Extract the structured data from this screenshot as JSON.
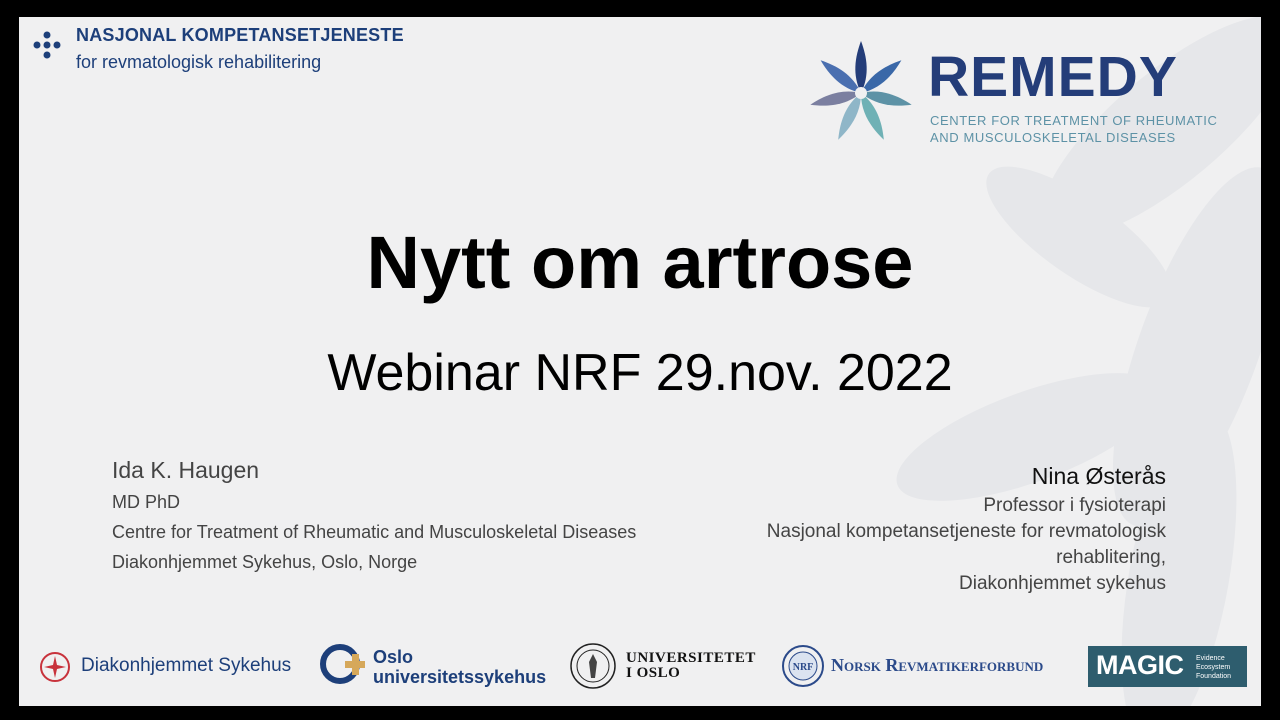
{
  "header": {
    "org_title": "NASJONAL KOMPETANSETJENESTE",
    "org_subtitle": "for revmatologisk rehabilitering",
    "remedy_name": "REMEDY",
    "remedy_tag1": "CENTER FOR TREATMENT OF RHEUMATIC",
    "remedy_tag2": "AND MUSCULOSKELETAL DISEASES"
  },
  "title": "Nytt om artrose",
  "subtitle": "Webinar NRF 29.nov. 2022",
  "presenter_left": {
    "name": "Ida K. Haugen",
    "degree": "MD PhD",
    "affiliation": "Centre for Treatment of Rheumatic and Musculoskeletal Diseases",
    "location": "Diakonhjemmet Sykehus, Oslo, Norge"
  },
  "presenter_right": {
    "name": "Nina Østerås",
    "role": "Professor i fysioterapi",
    "affiliation_line1": "Nasjonal kompetansetjeneste for revmatologisk",
    "affiliation_line2": "rehablitering,",
    "hospital": "Diakonhjemmet sykehus"
  },
  "logos": {
    "diakonhjemmet": "Diakonhjemmet Sykehus",
    "ous_line1": "Oslo",
    "ous_line2": "universitetssykehus",
    "uio_line1": "UNIVERSITETET",
    "uio_line2": "I OSLO",
    "nrf": "Norsk Revmatikerforbund",
    "magic_name": "MAGIC",
    "magic_sub1": "Evidence",
    "magic_sub2": "Ecosystem",
    "magic_sub3": "Foundation"
  },
  "colors": {
    "navy": "#1d3f7a",
    "remedy_navy": "#243d79",
    "teal": "#5d92a6",
    "ous_red": "#c8323c",
    "ous_gold": "#d6a85a",
    "magic_bg": "#2e5d6e"
  }
}
